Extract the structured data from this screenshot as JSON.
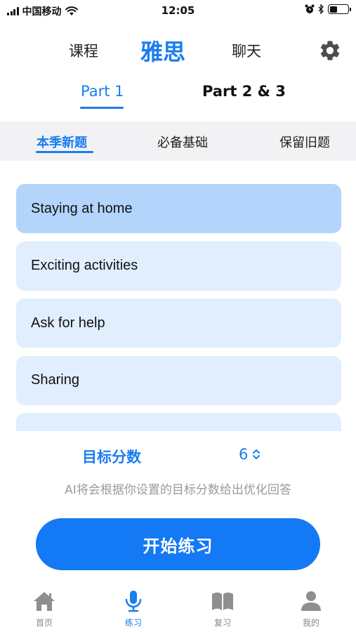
{
  "status_bar": {
    "carrier": "中国移动",
    "time": "12:05",
    "signal_icon": "signal-icon",
    "wifi_icon": "wifi-icon",
    "alarm_icon": "alarm-icon",
    "bluetooth_icon": "bluetooth-icon",
    "battery_level": 0.4
  },
  "top_tabs": {
    "items": [
      {
        "label": "课程",
        "active": false
      },
      {
        "label": "雅思",
        "active": true
      },
      {
        "label": "聊天",
        "active": false
      }
    ],
    "settings_icon": "gear-icon"
  },
  "part_tabs": {
    "items": [
      {
        "label": "Part 1",
        "active": true
      },
      {
        "label": "Part 2 & 3",
        "active": false
      }
    ]
  },
  "sub_tabs": {
    "items": [
      {
        "label": "本季新题",
        "active": true
      },
      {
        "label": "必备基础",
        "active": false
      },
      {
        "label": "保留旧题",
        "active": false
      }
    ]
  },
  "topics": [
    {
      "label": "Staying at home",
      "selected": true
    },
    {
      "label": "Exciting activities",
      "selected": false
    },
    {
      "label": "Ask for help",
      "selected": false
    },
    {
      "label": "Sharing",
      "selected": false
    }
  ],
  "target": {
    "label": "目标分数",
    "value": "6",
    "hint": "AI将会根据你设置的目标分数给出优化回答"
  },
  "start_button": {
    "label": "开始练习"
  },
  "bottom_nav": {
    "items": [
      {
        "label": "首页",
        "icon": "home-icon",
        "active": false
      },
      {
        "label": "练习",
        "icon": "microphone-icon",
        "active": true
      },
      {
        "label": "复习",
        "icon": "book-icon",
        "active": false
      },
      {
        "label": "我的",
        "icon": "user-icon",
        "active": false
      }
    ]
  },
  "colors": {
    "accent": "#1a7df0",
    "button": "#1479f5",
    "topic_bg": "#e0eefe",
    "topic_selected_bg": "#b3d4fb",
    "subtab_bg": "#f2f2f4"
  }
}
